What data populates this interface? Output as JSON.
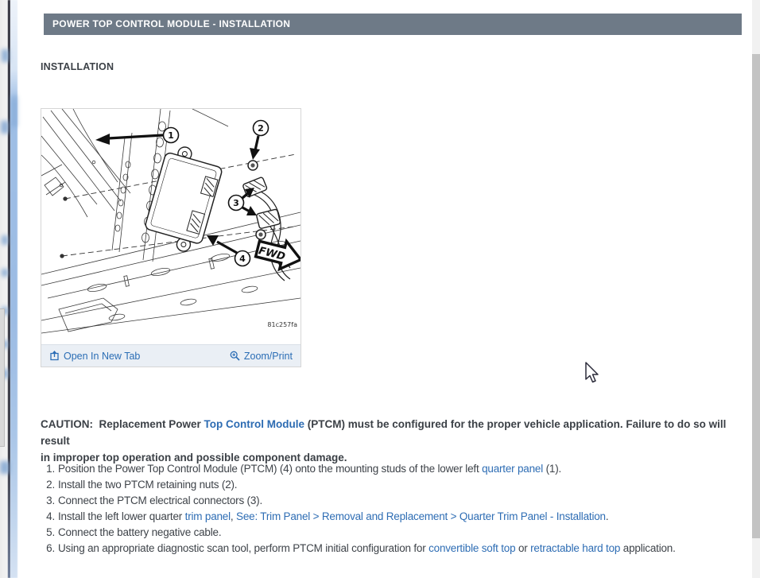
{
  "header": {
    "title": "POWER TOP CONTROL MODULE - INSTALLATION"
  },
  "section": {
    "heading": "INSTALLATION"
  },
  "figure": {
    "code": "81c257fa",
    "fwd_label": "FWD",
    "callouts": {
      "c1": "1",
      "c2": "2",
      "c3": "3",
      "c4": "4"
    },
    "toolbar": {
      "open_in_new_tab": "Open In New Tab",
      "zoom_print": "Zoom/Print"
    }
  },
  "caution": {
    "before_link": "CAUTION:  Replacement Power ",
    "link": "Top Control Module",
    "after_link_line1": " (PTCM) must be configured for the proper vehicle application. Failure to do so will result",
    "line2": "in improper top operation and possible component damage."
  },
  "steps": [
    {
      "num": "1.",
      "segments": [
        {
          "text": "Position the Power Top Control Module (PTCM) (4) onto the mounting studs of the lower left "
        },
        {
          "text": "quarter panel",
          "link": true
        },
        {
          "text": " (1)."
        }
      ]
    },
    {
      "num": "2.",
      "segments": [
        {
          "text": "Install the two PTCM retaining nuts (2)."
        }
      ]
    },
    {
      "num": "3.",
      "segments": [
        {
          "text": "Connect the PTCM electrical connectors (3)."
        }
      ]
    },
    {
      "num": "4.",
      "segments": [
        {
          "text": "Install the left lower quarter "
        },
        {
          "text": "trim panel",
          "link": true
        },
        {
          "text": ", "
        },
        {
          "text": "See: Trim Panel > Removal and Replacement > Quarter Trim Panel - Installation",
          "link": true
        },
        {
          "text": "."
        }
      ]
    },
    {
      "num": "5.",
      "segments": [
        {
          "text": "Connect the battery negative cable."
        }
      ]
    },
    {
      "num": "6.",
      "segments": [
        {
          "text": "Using an appropriate diagnostic scan tool, perform PTCM initial configuration for "
        },
        {
          "text": "convertible soft top",
          "link": true
        },
        {
          "text": " or "
        },
        {
          "text": "retractable hard top",
          "link": true
        },
        {
          "text": " application."
        }
      ]
    }
  ],
  "colors": {
    "header_bar": "#6e7a87",
    "link_blue": "#2a6db5",
    "toolbar_bg": "#eaeff5",
    "scrollbar_thumb": "#c3c3c3",
    "sidebar_blue": "#9cbce4"
  }
}
